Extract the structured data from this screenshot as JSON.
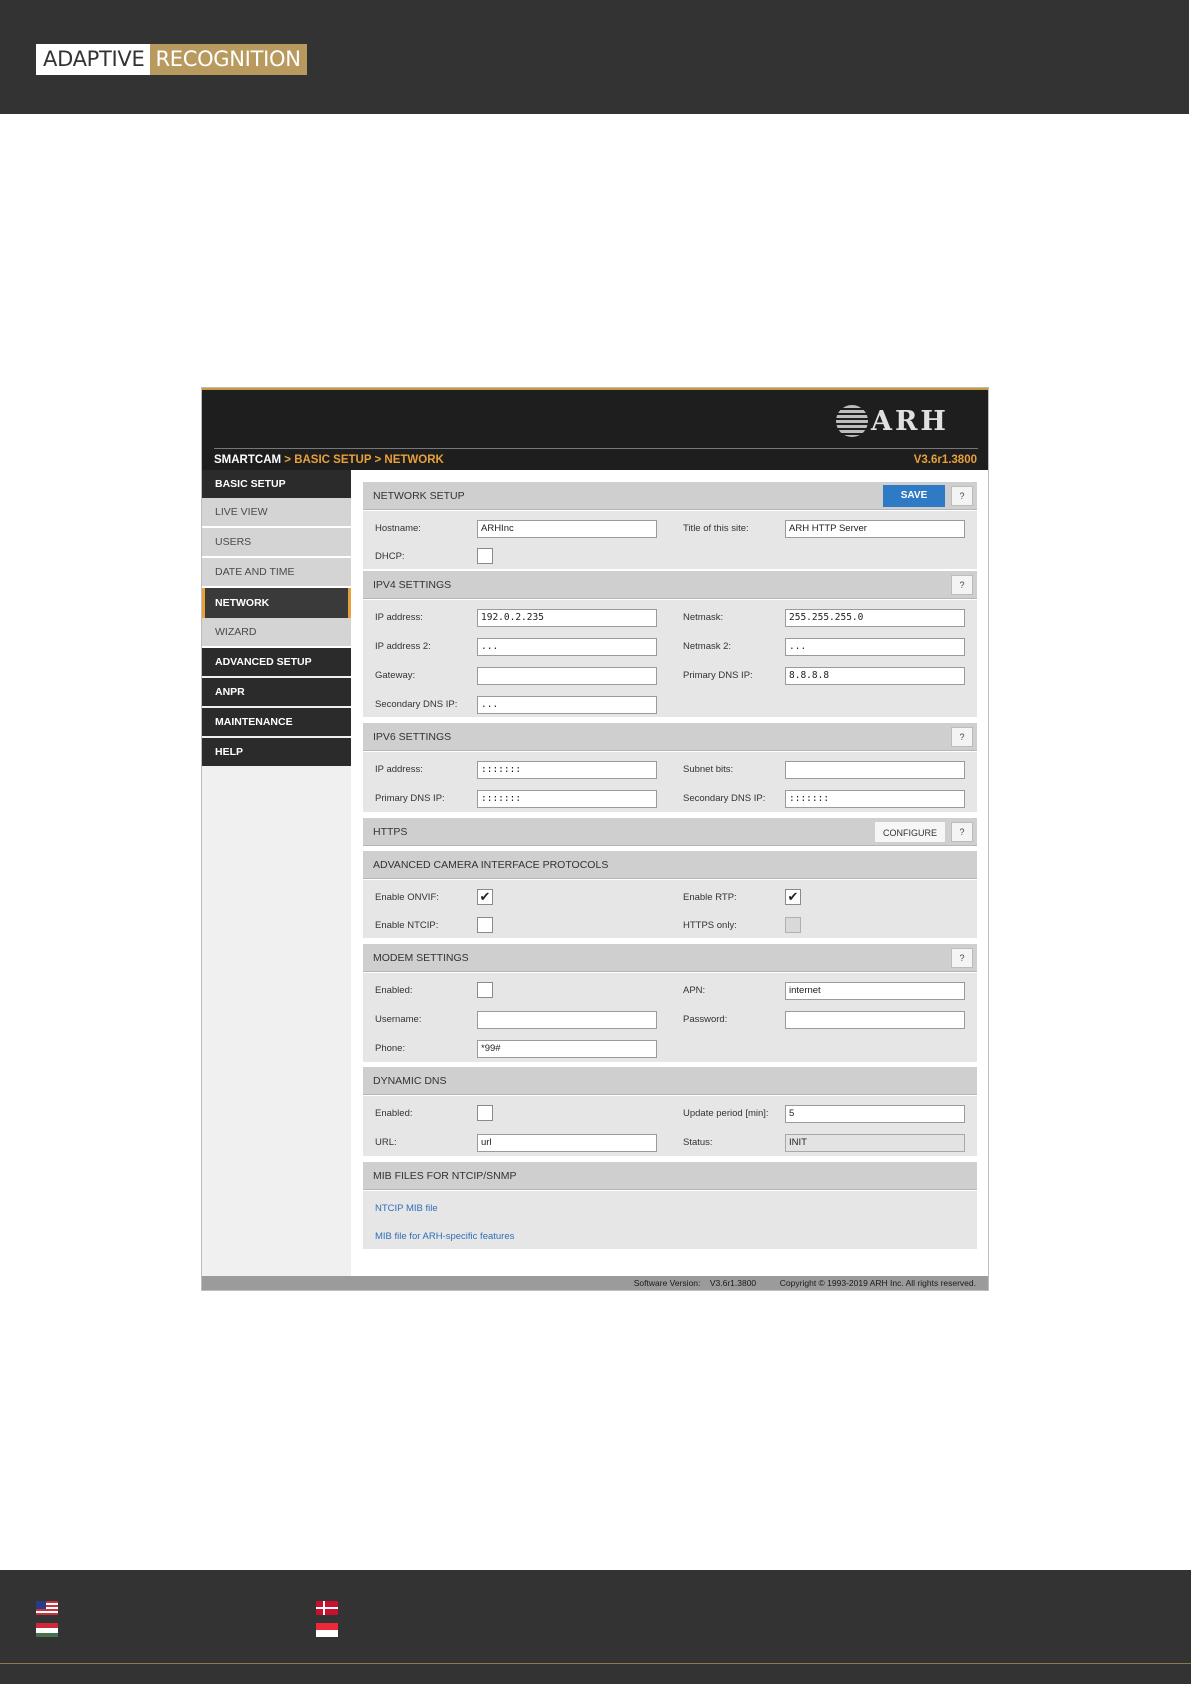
{
  "doc": {
    "logo_left": "ADAPTIVE",
    "logo_right": "RECOGNITION"
  },
  "app": {
    "brand": "ARH",
    "breadcrumb": {
      "root": "SMARTCAM",
      "sep1": " > ",
      "level1": "BASIC SETUP",
      "sep2": " > ",
      "level2": "NETWORK"
    },
    "version": "V3.6r1.3800",
    "sidebar": {
      "items": [
        {
          "label": "BASIC SETUP"
        },
        {
          "label": "LIVE VIEW"
        },
        {
          "label": "USERS"
        },
        {
          "label": "DATE AND TIME"
        },
        {
          "label": "NETWORK"
        },
        {
          "label": "WIZARD"
        },
        {
          "label": "ADVANCED SETUP"
        },
        {
          "label": "ANPR"
        },
        {
          "label": "MAINTENANCE"
        },
        {
          "label": "HELP"
        }
      ]
    },
    "help_label": "?",
    "network": {
      "title": "NETWORK SETUP",
      "save": "SAVE",
      "hostname_label": "Hostname:",
      "hostname": "ARHInc",
      "site_title_label": "Title of this site:",
      "site_title": "ARH HTTP Server",
      "dhcp_label": "DHCP:"
    },
    "ipv4": {
      "title": "IPV4 SETTINGS",
      "ip_label": "IP address:",
      "ip": "192.0.2.235",
      "netmask_label": "Netmask:",
      "netmask": "255.255.255.0",
      "ip2_label": "IP address 2:",
      "ip2": "...",
      "netmask2_label": "Netmask 2:",
      "netmask2": "...",
      "gateway_label": "Gateway:",
      "gateway": "",
      "dns1_label": "Primary DNS IP:",
      "dns1": "8.8.8.8",
      "dns2_label": "Secondary DNS IP:",
      "dns2": "..."
    },
    "ipv6": {
      "title": "IPV6 SETTINGS",
      "ip_label": "IP address:",
      "ip": ":::::::",
      "subnet_label": "Subnet bits:",
      "subnet": "",
      "dns1_label": "Primary DNS IP:",
      "dns1": ":::::::",
      "dns2_label": "Secondary DNS IP:",
      "dns2": ":::::::"
    },
    "https": {
      "title": "HTTPS",
      "configure": "CONFIGURE"
    },
    "protocols": {
      "title": "ADVANCED CAMERA INTERFACE PROTOCOLS",
      "onvif_label": "Enable ONVIF:",
      "onvif": true,
      "rtp_label": "Enable RTP:",
      "rtp": true,
      "ntcip_label": "Enable NTCIP:",
      "ntcip": false,
      "https_only_label": "HTTPS only:",
      "https_only": false
    },
    "modem": {
      "title": "MODEM SETTINGS",
      "enabled_label": "Enabled:",
      "enabled": false,
      "apn_label": "APN:",
      "apn": "internet",
      "username_label": "Username:",
      "username": "",
      "password_label": "Password:",
      "password": "",
      "phone_label": "Phone:",
      "phone": "*99#"
    },
    "ddns": {
      "title": "DYNAMIC DNS",
      "enabled_label": "Enabled:",
      "enabled": false,
      "period_label": "Update period [min]:",
      "period": "5",
      "url_label": "URL:",
      "url": "url",
      "status_label": "Status:",
      "status": "INIT"
    },
    "mib": {
      "title": "MIB FILES FOR NTCIP/SNMP",
      "link1": "NTCIP MIB file",
      "link2": "MIB file for ARH-specific features"
    },
    "footer": {
      "sw_label": "Software Version:",
      "sw_version": "V3.6r1.3800",
      "copyright": "Copyright © 1993-2019 ARH Inc. All rights reserved."
    },
    "check_glyph": "✔"
  }
}
